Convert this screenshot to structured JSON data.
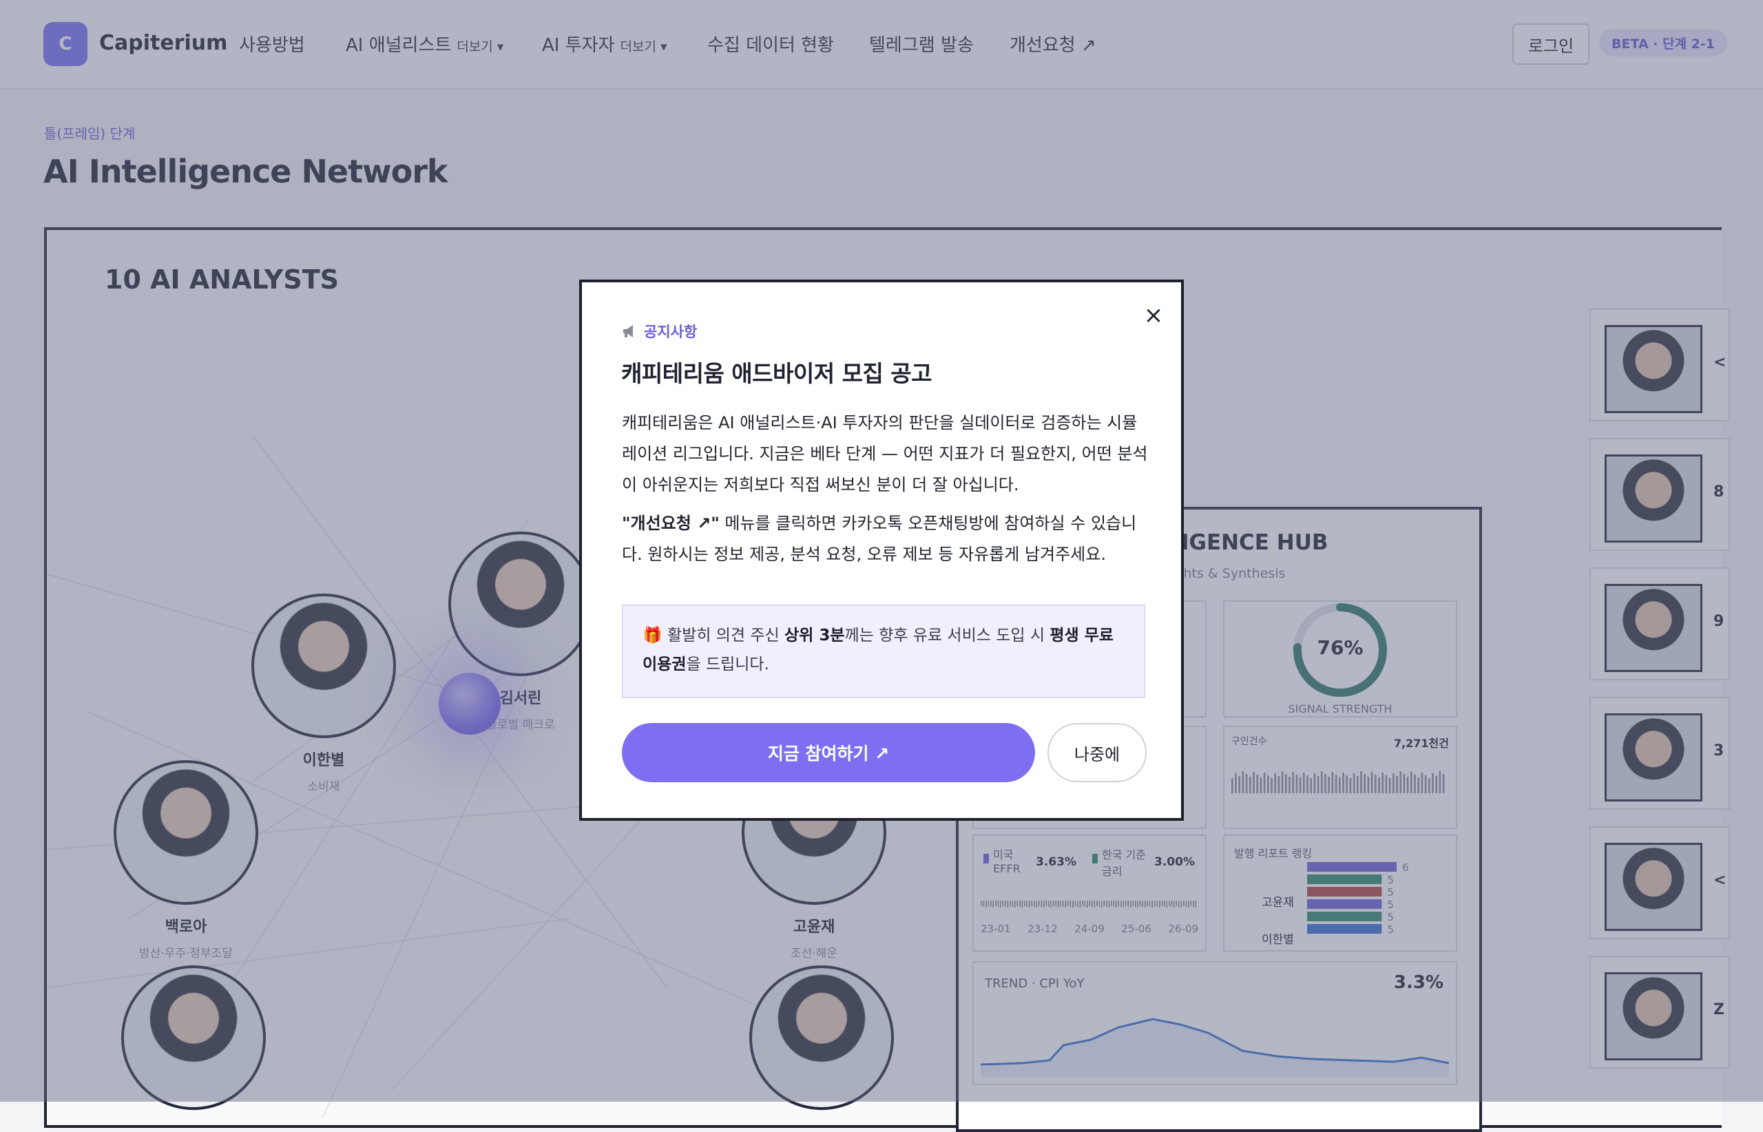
{
  "header": {
    "logo_letter": "C",
    "brand": "Capiterium",
    "nav": [
      {
        "label": "사용방법",
        "more": ""
      },
      {
        "label": "AI 애널리스트",
        "more": "더보기 ▾"
      },
      {
        "label": "AI 투자자",
        "more": "더보기 ▾"
      },
      {
        "label": "수집 데이터 현황",
        "more": ""
      },
      {
        "label": "텔레그램 발송",
        "more": ""
      },
      {
        "label": "개선요청 ↗",
        "more": ""
      }
    ],
    "login": "로그인",
    "beta": "BETA · 단계 2-1"
  },
  "breadcrumb": "틀(프레임) 단계",
  "page_title": "AI Intelligence Network",
  "panel": {
    "title": "10 AI ANALYSTS",
    "analysts": [
      {
        "name": "김서린",
        "sector": "글로벌 매크로"
      },
      {
        "name": "이한별",
        "sector": "소비재"
      },
      {
        "name": "백로아",
        "sector": "방산·우주·정부조달"
      },
      {
        "name": "고윤재",
        "sector": "조선·해운"
      }
    ],
    "side_letters": [
      "<",
      "8",
      "9",
      "3",
      "<",
      "Z"
    ]
  },
  "hub": {
    "title": "LLIGENCE HUB",
    "subtitle": "Insights & Synthesis",
    "gauge_value": "76%",
    "gauge_fraction": 0.76,
    "gauge_label": "SIGNAL STRENGTH",
    "job_label": "구인건수",
    "job_value": "7,271천건",
    "rates": [
      {
        "name": "미국 EFFR",
        "value": "3.63%",
        "color": "#6a5fd8"
      },
      {
        "name": "한국 기준 금리",
        "value": "3.00%",
        "color": "#2f8a6a"
      }
    ],
    "rate_axis": [
      "23-01",
      "23-12",
      "24-09",
      "25-06",
      "26-09"
    ],
    "ranking_title": "발행 리포트 랭킹",
    "ranking_names": [
      "고윤재",
      "이한별"
    ],
    "ranking_values": [
      6,
      5,
      5,
      5,
      5,
      5
    ],
    "ranking_colors": [
      "#6a5fd8",
      "#2f8a6a",
      "#b3463e",
      "#6a5fd8",
      "#2f8a6a",
      "#3a6fd0"
    ],
    "trend_label": "TREND · CPI YoY",
    "trend_value": "3.3%"
  },
  "modal": {
    "notice_icon": "megaphone-icon",
    "notice": "공지사항",
    "title": "캐피테리움 애드바이저 모집 공고",
    "p1": "캐피테리움은 AI 애널리스트·AI 투자자의 판단을 실데이터로 검증하는 시뮬레이션 리그입니다. 지금은 베타 단계 — 어떤 지표가 더 필요한지, 어떤 분석이 아쉬운지는 저희보다 직접 써보신 분이 더 잘 아십니다.",
    "p2_bold": "\"개선요청 ↗\"",
    "p2_rest": " 메뉴를 클릭하면 카카오톡 오픈채팅방에 참여하실 수 있습니다. 원하시는 정보 제공, 분석 요청, 오류 제보 등 자유롭게 남겨주세요.",
    "gift_icon": "gift-icon",
    "gift_1": " 활발히 의견 주신 ",
    "gift_b1": "상위 3분",
    "gift_2": "께는 향후 유료 서비스 도입 시 ",
    "gift_b2": "평생 무료 이용권",
    "gift_3": "을 드립니다.",
    "join": "지금 참여하기 ↗",
    "later": "나중에",
    "close": "×"
  }
}
